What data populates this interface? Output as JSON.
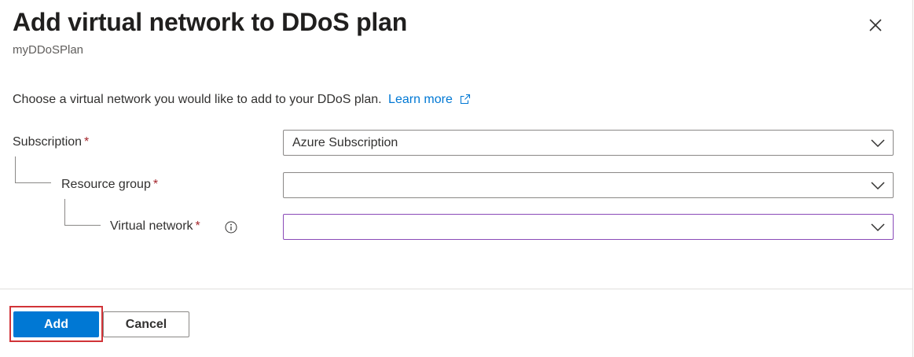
{
  "header": {
    "title": "Add virtual network to DDoS plan",
    "subtitle": "myDDoSPlan"
  },
  "intro": {
    "text": "Choose a virtual network you would like to add to your DDoS plan.",
    "link_label": "Learn more"
  },
  "form": {
    "subscription": {
      "label": "Subscription",
      "required_mark": "*",
      "value": "Azure Subscription"
    },
    "resource_group": {
      "label": "Resource group",
      "required_mark": "*",
      "value": ""
    },
    "virtual_network": {
      "label": "Virtual network",
      "required_mark": "*",
      "value": ""
    }
  },
  "footer": {
    "add_label": "Add",
    "cancel_label": "Cancel"
  },
  "colors": {
    "primary": "#0078d4",
    "required": "#a4262c",
    "highlight": "#d13438",
    "focus_border": "#8a4ab8"
  },
  "icons": [
    "close-icon",
    "external-link-icon",
    "info-icon",
    "chevron-down-icon"
  ]
}
